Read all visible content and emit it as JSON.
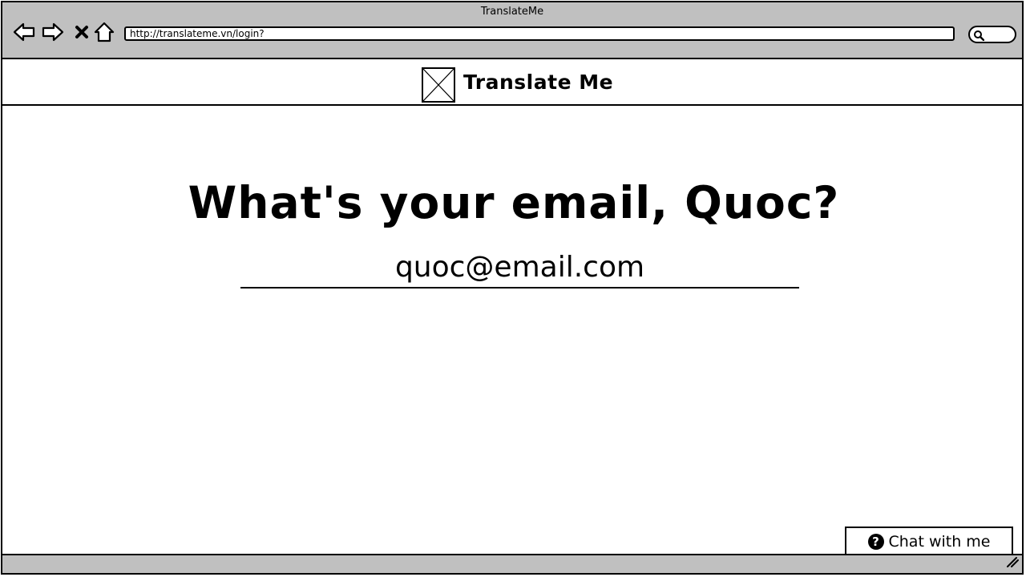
{
  "window": {
    "title": "TranslateMe"
  },
  "toolbar": {
    "url": "http://translateme.vn/login?",
    "icons": [
      "back-arrow-icon",
      "forward-arrow-icon",
      "close-icon",
      "home-icon",
      "search-icon"
    ]
  },
  "header": {
    "brand": "Translate Me",
    "logo_icon": "image-placeholder-icon"
  },
  "main": {
    "headline": "What's your email, Quoc?",
    "email_value": "quoc@email.com"
  },
  "chat": {
    "label": "Chat with me",
    "icon": "question-circle-icon"
  },
  "colors": {
    "chrome": "#c0c0c0",
    "border": "#000000",
    "background": "#ffffff"
  }
}
